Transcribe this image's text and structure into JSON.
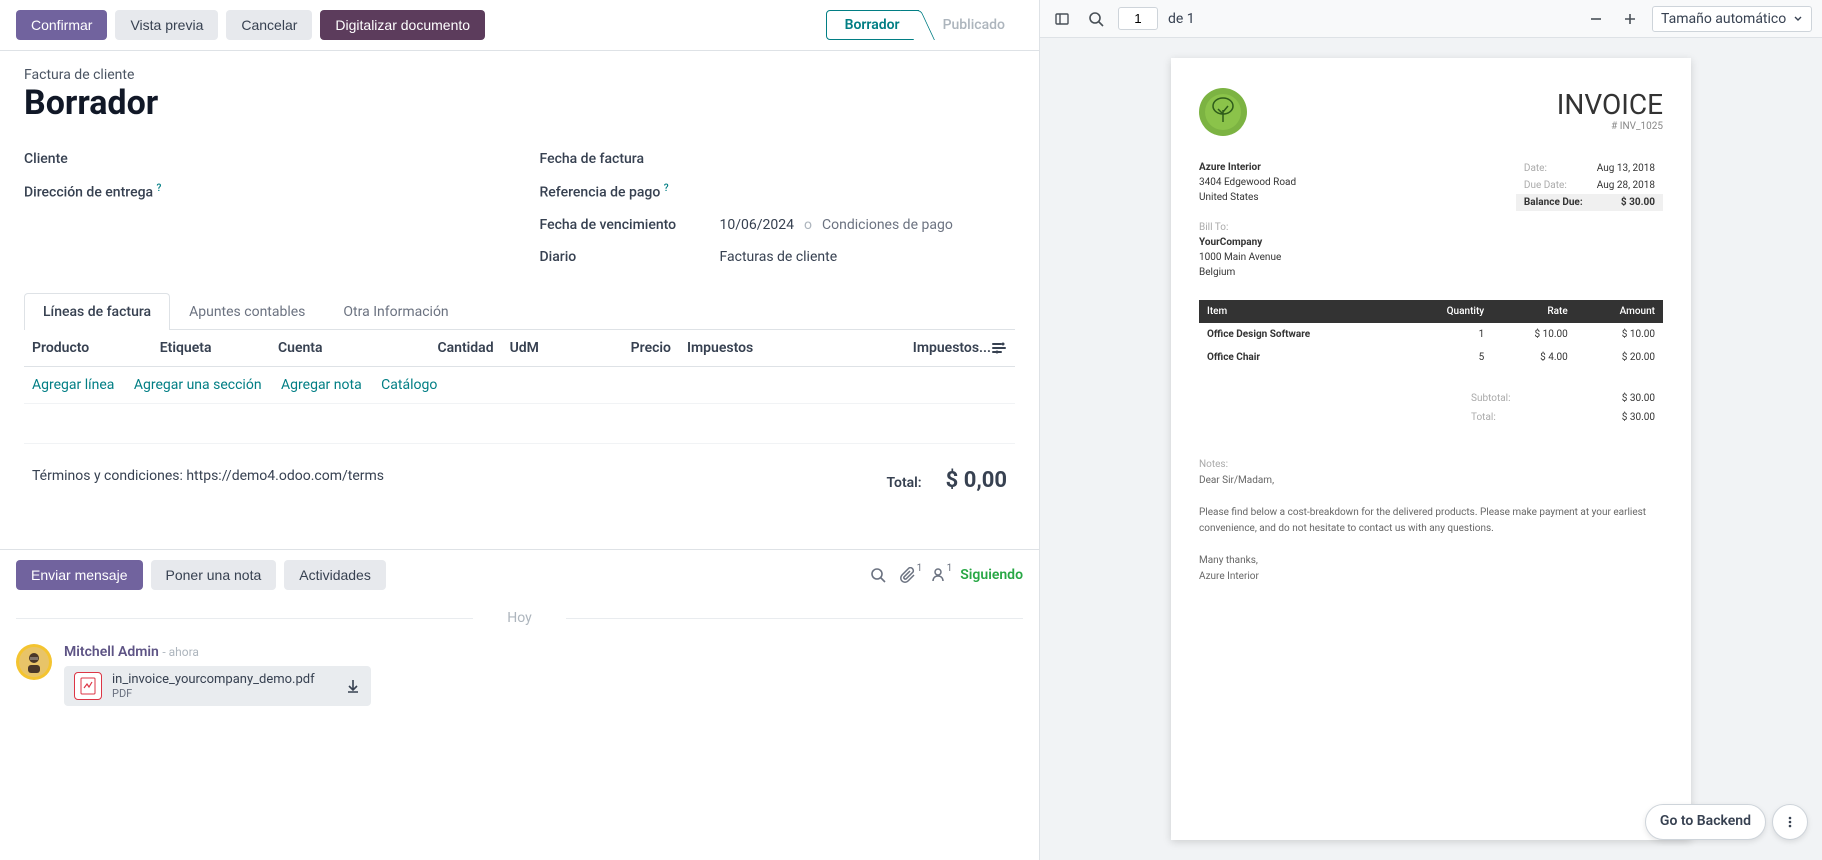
{
  "actions": {
    "confirm": "Confirmar",
    "preview": "Vista previa",
    "cancel": "Cancelar",
    "digitize": "Digitalizar documento"
  },
  "status": {
    "draft": "Borrador",
    "posted": "Publicado"
  },
  "form": {
    "doc_type": "Factura de cliente",
    "title": "Borrador",
    "labels": {
      "client": "Cliente",
      "delivery_address": "Dirección de entrega",
      "invoice_date": "Fecha de factura",
      "payment_ref": "Referencia de pago",
      "due_date": "Fecha de vencimiento",
      "journal": "Diario",
      "payment_terms": "Condiciones de pago"
    },
    "values": {
      "due_date": "10/06/2024",
      "journal": "Facturas de cliente",
      "sep": "o"
    }
  },
  "tabs": {
    "lines": "Líneas de factura",
    "entries": "Apuntes contables",
    "other": "Otra Información"
  },
  "table": {
    "headers": {
      "product": "Producto",
      "label": "Etiqueta",
      "account": "Cuenta",
      "qty": "Cantidad",
      "uom": "UdM",
      "price": "Precio",
      "taxes": "Impuestos",
      "tax_excl": "Impuestos..."
    },
    "links": {
      "add_line": "Agregar línea",
      "add_section": "Agregar una sección",
      "add_note": "Agregar nota",
      "catalog": "Catálogo"
    }
  },
  "footer": {
    "terms": "Términos y condiciones: https://demo4.odoo.com/terms",
    "total_label": "Total:",
    "total_value": "$ 0,00"
  },
  "chatter": {
    "send": "Enviar mensaje",
    "note": "Poner una nota",
    "activities": "Actividades",
    "following": "Siguiendo",
    "attach_count": "1",
    "follower_count": "1",
    "today": "Hoy",
    "author": "Mitchell Admin",
    "time": "- ahora",
    "attachment_name": "in_invoice_yourcompany_demo.pdf",
    "attachment_type": "PDF"
  },
  "pdf_toolbar": {
    "page": "1",
    "of": "de 1",
    "zoom": "Tamaño automático"
  },
  "invoice": {
    "title": "INVOICE",
    "number": "# INV_1025",
    "from_name": "Azure Interior",
    "from_addr1": "3404 Edgewood Road",
    "from_addr2": "United States",
    "bill_to_label": "Bill To:",
    "to_name": "YourCompany",
    "to_addr1": "1000 Main Avenue",
    "to_addr2": "Belgium",
    "meta": {
      "date_label": "Date:",
      "date": "Aug 13, 2018",
      "due_label": "Due Date:",
      "due": "Aug 28, 2018",
      "balance_label": "Balance Due:",
      "balance": "$ 30.00"
    },
    "headers": {
      "item": "Item",
      "qty": "Quantity",
      "rate": "Rate",
      "amount": "Amount"
    },
    "items": [
      {
        "name": "Office Design Software",
        "qty": "1",
        "rate": "$ 10.00",
        "amount": "$ 10.00"
      },
      {
        "name": "Office Chair",
        "qty": "5",
        "rate": "$ 4.00",
        "amount": "$ 20.00"
      }
    ],
    "subtotal_label": "Subtotal:",
    "subtotal": "$ 30.00",
    "total_label": "Total:",
    "total": "$ 30.00",
    "notes_label": "Notes:",
    "greeting": "Dear Sir/Madam,",
    "body": "Please find below a cost-breakdown for the delivered products. Please make payment at your earliest convenience, and do not hesitate to contact us with any questions.",
    "thanks": "Many thanks,",
    "signature": "Azure Interior"
  },
  "backend": {
    "go": "Go to Backend"
  }
}
